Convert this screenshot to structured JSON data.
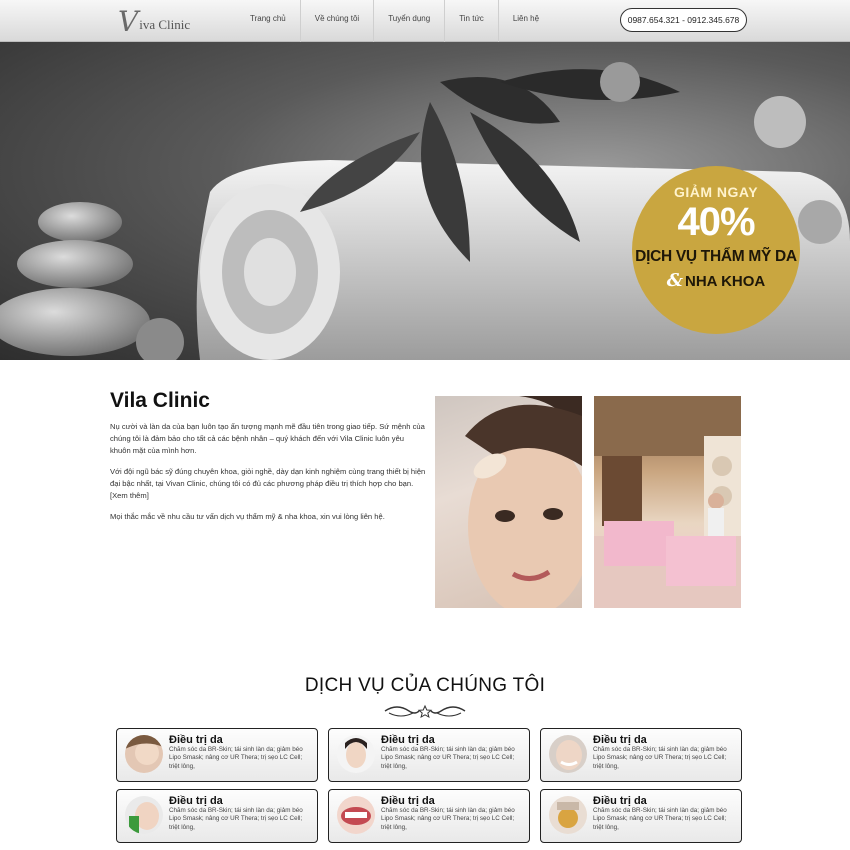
{
  "header": {
    "logo_initial": "V",
    "logo_text": "iva Clinic",
    "nav": [
      "Trang chủ",
      "Về chúng tôi",
      "Tuyển dụng",
      "Tin tức",
      "Liên hệ"
    ],
    "phone": "0987.654.321 - 0912.345.678"
  },
  "hero": {
    "promo": {
      "line1": "GIẢM NGAY",
      "line2": "40%",
      "line3": "DỊCH VỤ THẨM MỸ DA",
      "amp": "&",
      "line4": "NHA KHOA",
      "color": "#c9a640"
    }
  },
  "about": {
    "title": "Vila Clinic",
    "paragraphs": [
      "Nụ cười và làn da của bạn luôn tạo ấn tượng mạnh mẽ đầu tiên trong giao tiếp. Sứ mệnh của chúng tôi là đảm bảo cho tất cả các bệnh nhân – quý khách đến với Vila Clinic luôn yêu khuôn mặt của mình hơn.",
      "Với đội ngũ bác sỹ đúng chuyên khoa, giỏi nghề, dày dạn kinh nghiệm cùng trang thiết bị hiện đại bậc nhất, tại Vivan Clinic, chúng tôi có đủ các phương pháp điều trị thích hợp cho bạn. [Xem thêm]",
      "Mọi thắc mắc về nhu cầu tư vấn dịch vụ thẩm mỹ & nha khoa, xin vui lòng liên hệ."
    ]
  },
  "services": {
    "title": "DỊCH VỤ CỦA CHÚNG TÔI",
    "ornament_icon": "star-flourish-icon",
    "items": [
      {
        "name": "Điều trị da",
        "desc": "Chăm sóc da BR-Skin; tái sinh làn da; giảm béo Lipo Smask; nâng cơ UR Thera; trị sẹo LC Cell; triệt lông,"
      },
      {
        "name": "Điều trị da",
        "desc": "Chăm sóc da BR-Skin; tái sinh làn da; giảm béo Lipo Smask; nâng cơ UR Thera; trị sẹo LC Cell; triệt lông,"
      },
      {
        "name": "Điều trị da",
        "desc": "Chăm sóc da BR-Skin; tái sinh làn da; giảm béo Lipo Smask; nâng cơ UR Thera; trị sẹo LC Cell; triệt lông,"
      },
      {
        "name": "Điều trị da",
        "desc": "Chăm sóc da BR-Skin; tái sinh làn da; giảm béo Lipo Smask; nâng cơ UR Thera; trị sẹo LC Cell; triệt lông,"
      },
      {
        "name": "Điều trị da",
        "desc": "Chăm sóc da BR-Skin; tái sinh làn da; giảm béo Lipo Smask; nâng cơ UR Thera; trị sẹo LC Cell; triệt lông,"
      },
      {
        "name": "Điều trị da",
        "desc": "Chăm sóc da BR-Skin; tái sinh làn da; giảm béo Lipo Smask; nâng cơ UR Thera; trị sẹo LC Cell; triệt lông,"
      }
    ]
  }
}
